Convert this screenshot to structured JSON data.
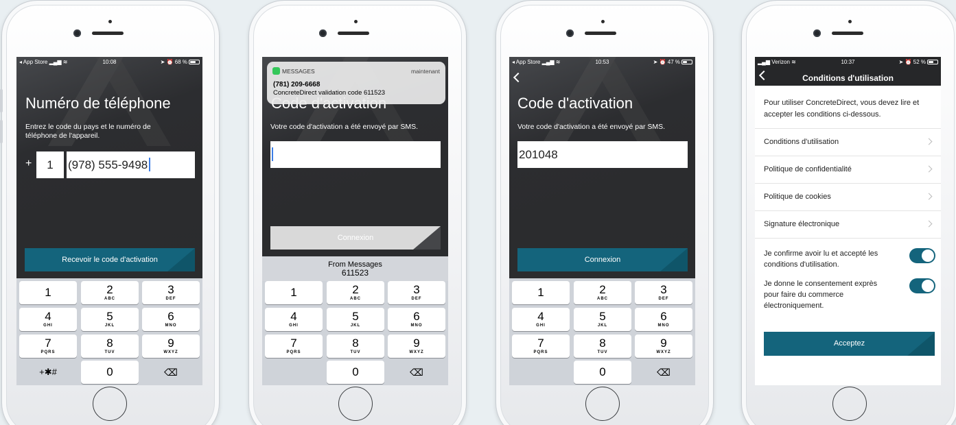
{
  "phones": [
    {
      "status": {
        "carrier": "App Store",
        "time": "10:08",
        "right": "68 %"
      },
      "title": "Numéro de téléphone",
      "subtitle_line1": "Entrez le code du pays et le numéro de",
      "subtitle_line2": "téléphone de l'appareil.",
      "plus": "+",
      "country_code": "1",
      "phone_number": "(978) 555-9498",
      "button": "Recevoir le code d'activation"
    },
    {
      "notification": {
        "app": "MESSAGES",
        "time": "maintenant",
        "sender": "(781) 209-6668",
        "body": "ConcreteDirect validation code 611523"
      },
      "title": "Code d'activation",
      "subtitle": "Votre code d'activation a été envoyé par SMS.",
      "code_value": "",
      "button": "Connexion",
      "suggestion_line1": "From Messages",
      "suggestion_line2": "611523"
    },
    {
      "status": {
        "carrier": "App Store",
        "time": "10:53",
        "right": "47 %"
      },
      "title": "Code d'activation",
      "subtitle": "Votre code d'activation a été envoyé par SMS.",
      "code_value": "201048",
      "button": "Connexion"
    },
    {
      "status": {
        "carrier": "Verizon",
        "time": "10:37",
        "right": "52 %"
      },
      "nav_title": "Conditions d'utilisation",
      "intro": "Pour utiliser ConcreteDirect, vous devez lire et accepter les conditions ci-dessous.",
      "rows": [
        "Conditions d'utilisation",
        "Politique de confidentialité",
        "Politique de cookies",
        "Signature électronique"
      ],
      "toggle1": "Je confirme avoir lu et accepté les conditions d'utilisation.",
      "toggle2": "Je donne le consentement exprès pour faire du commerce électroniquement.",
      "button": "Acceptez"
    }
  ],
  "keypad": {
    "k1": "1",
    "k2": "2",
    "k2l": "ABC",
    "k3": "3",
    "k3l": "DEF",
    "k4": "4",
    "k4l": "GHI",
    "k5": "5",
    "k5l": "JKL",
    "k6": "6",
    "k6l": "MNO",
    "k7": "7",
    "k7l": "PQRS",
    "k8": "8",
    "k8l": "TUV",
    "k9": "9",
    "k9l": "WXYZ",
    "k0": "0",
    "sym": "+✱#",
    "del": "⌫"
  },
  "colors": {
    "teal": "#14647c",
    "dark": "#262729",
    "background": "#e9eff2"
  }
}
